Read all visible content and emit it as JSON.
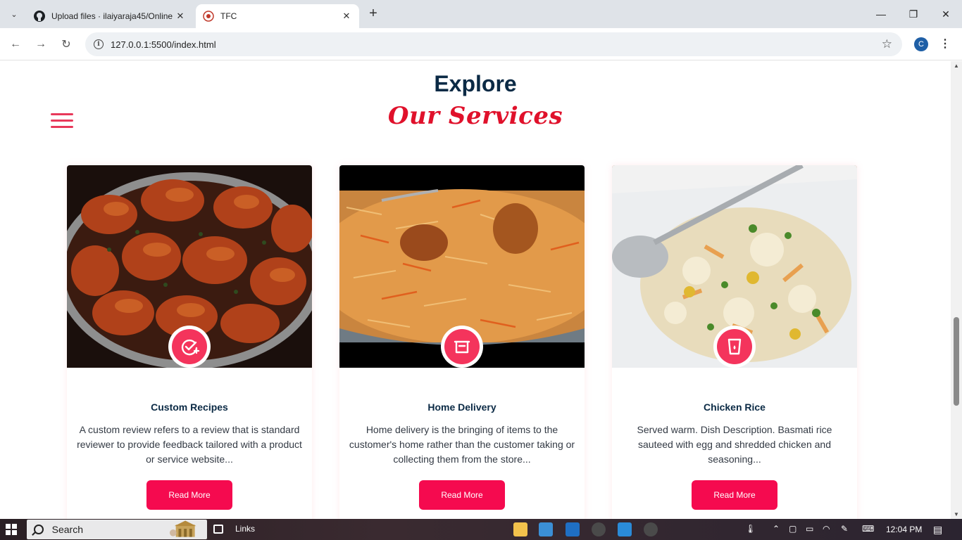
{
  "browser": {
    "tabs": [
      {
        "title": "Upload files · ilaiyaraja45/Online",
        "active": false
      },
      {
        "title": "TFC",
        "active": true
      }
    ],
    "url": "127.0.0.1:5500/index.html",
    "profile_initial": "C"
  },
  "page": {
    "heading": "Explore",
    "subheading": "Our Services",
    "colors": {
      "accent": "#f50a4f",
      "heading": "#0b2a45",
      "script": "#e0112b"
    },
    "cards": [
      {
        "title": "Custom Recipes",
        "description": "A custom review refers to a review that is standard reviewer to provide feedback tailored with a product or service website...",
        "button": "Read More",
        "icon": "checkmark-plus-icon",
        "image": "chicken-dish-photo"
      },
      {
        "title": "Home Delivery",
        "description": "Home delivery is the bringing of items to the customer's home rather than the customer taking or collecting them from the store...",
        "button": "Read More",
        "icon": "basket-icon",
        "image": "biryani-photo"
      },
      {
        "title": "Chicken Rice",
        "description": "Served warm. Dish Description. Basmati rice sauteed with egg and shredded chicken and seasoning...",
        "button": "Read More",
        "icon": "cup-icon",
        "image": "fried-rice-photo"
      }
    ]
  },
  "taskbar": {
    "search_label": "Search",
    "links_label": "Links",
    "time": "12:04 PM"
  }
}
